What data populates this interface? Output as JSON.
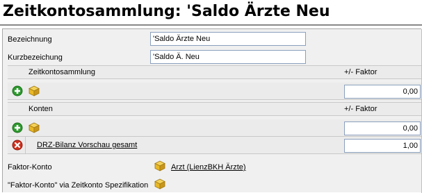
{
  "title": "Zeitkontosammlung: 'Saldo Ärzte Neu",
  "form": {
    "bezeichnung_label": "Bezeichnung",
    "bezeichnung_value": "'Saldo Ärzte Neu",
    "kurz_label": "Kurzbezeichung",
    "kurz_value": "'Saldo Ä. Neu"
  },
  "zeitkontosammlung": {
    "header": "Zeitkontosammlung",
    "factor_header": "+/- Faktor",
    "rows": [
      {
        "factor": "0,00"
      }
    ]
  },
  "konten": {
    "header": "Konten",
    "factor_header": "+/- Faktor",
    "new_row_factor": "0,00",
    "rows": [
      {
        "name": "DRZ-Bilanz Vorschau gesamt",
        "factor": "1,00"
      }
    ]
  },
  "faktor_konto": {
    "label": "Faktor-Konto",
    "value": "Arzt (LienzBKH Ärzte)"
  },
  "faktor_spez": {
    "label": "\"Faktor-Konto\" via Zeitkonto Spezifikation"
  },
  "icons": {
    "add": "add-circle-icon",
    "remove": "remove-circle-icon",
    "cube": "cube-icon"
  },
  "colors": {
    "add": "#2e9a2e",
    "remove": "#d0301e",
    "cube": "#e8b828"
  }
}
